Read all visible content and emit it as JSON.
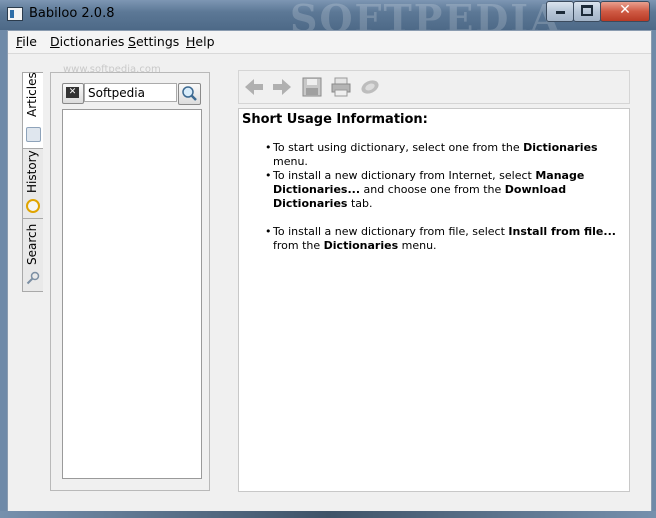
{
  "window": {
    "title": "Babiloo 2.0.8",
    "watermark": "SOFTPEDIA",
    "watermark_url": "www.softpedia.com"
  },
  "menu": [
    {
      "label": "File",
      "accel": "F",
      "rest": "ile"
    },
    {
      "label": "Dictionaries",
      "accel": "D",
      "rest": "ictionaries"
    },
    {
      "label": "Settings",
      "accel": "S",
      "rest": "ettings"
    },
    {
      "label": "Help",
      "accel": "H",
      "rest": "elp"
    }
  ],
  "tabs": {
    "articles": "Articles",
    "history": "History",
    "search": "Search"
  },
  "search": {
    "value": "Softpedia"
  },
  "toolbar": {
    "icons": [
      "back-arrow-icon",
      "forward-arrow-icon",
      "save-icon",
      "print-icon",
      "speak-icon"
    ]
  },
  "content": {
    "heading": "Short Usage Information:",
    "bullet1_a": "To start using dictionary, select one from the ",
    "bullet1_b": "Dictionaries",
    "bullet1_c": " menu.",
    "bullet2_a": "To install a new dictionary from Internet, select ",
    "bullet2_b": "Manage Dictionaries...",
    "bullet2_c": " and choose one from the ",
    "bullet2_d": "Download Dictionaries",
    "bullet2_e": " tab.",
    "bullet3_a": "To install a new dictionary from file, select ",
    "bullet3_b": "Install from file...",
    "bullet3_c": " from the ",
    "bullet3_d": "Dictionaries",
    "bullet3_e": " menu."
  },
  "colors": {
    "titlebar": "#5c7896",
    "close_button": "#cf5a44",
    "client_bg": "#f0f0f0"
  }
}
